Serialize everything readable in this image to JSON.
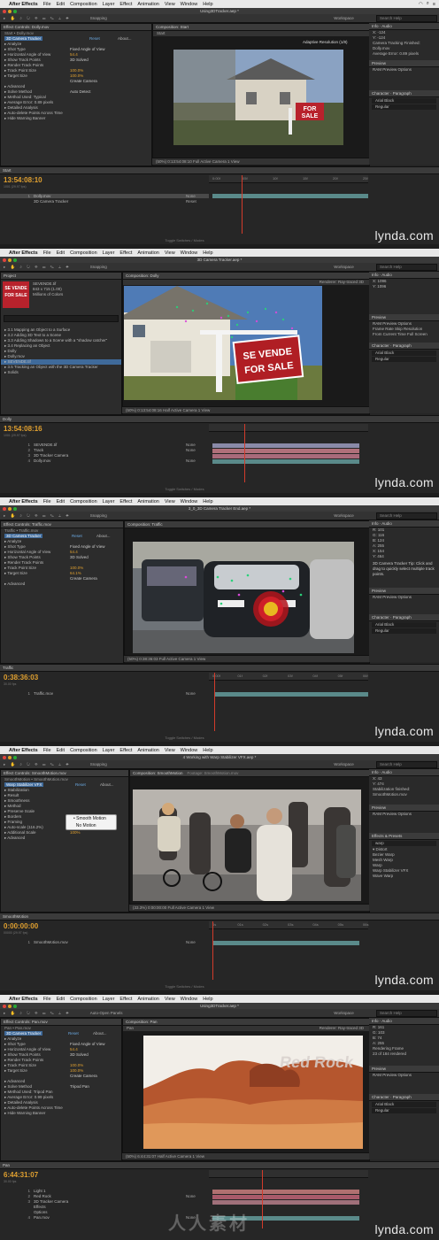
{
  "app": {
    "menu": [
      "After Effects",
      "File",
      "Edit",
      "Composition",
      "Layer",
      "Effect",
      "Animation",
      "View",
      "Window",
      "Help"
    ],
    "snapping": "Snapping",
    "workspace_label": "Workspace",
    "workspace_value": "Standard",
    "search_placeholder": "Search Help",
    "watermark_site": "lynda.com",
    "watermark_cn": "人人素材"
  },
  "frames": [
    {
      "title": "Using3DTracker.aep *",
      "left_panel_tab": "Effect Controls: Dolly.mov",
      "left_panel_path": "Start • Dolly.mov",
      "effect_name": "3D Camera Tracker",
      "reset": "Reset",
      "about": "About...",
      "props": [
        {
          "label": "Analyze",
          "value": ""
        },
        {
          "label": "Shot Type",
          "value": "Fixed Angle of View"
        },
        {
          "label": "Horizontal Angle of View",
          "value": "54.4"
        },
        {
          "label": "Show Track Points",
          "value": "3D Solved"
        },
        {
          "label": "Render Track Points",
          "value": ""
        },
        {
          "label": "Track Point Size",
          "value": "100.0%"
        },
        {
          "label": "Target Size",
          "value": "100.0%"
        },
        {
          "label": "",
          "value": "Create Camera"
        },
        {
          "label": "Advanced",
          "value": ""
        },
        {
          "label": "Solve Method",
          "value": "Auto Detect"
        },
        {
          "label": "Method Used: Typical",
          "value": ""
        },
        {
          "label": "Average Error: 0.89 pixels",
          "value": ""
        },
        {
          "label": "Detailed Analysis",
          "value": ""
        },
        {
          "label": "Auto-delete Points Across Time",
          "value": ""
        },
        {
          "label": "Hide Warning Banner",
          "value": ""
        }
      ],
      "comp_tab": "Composition: Start",
      "comp_sub": "Start",
      "viewer_overlay": "Adaptive Resolution (1/8)",
      "viewer_bar": "(50%)   0:13:54:08:10   Full   Active Camera   1 View",
      "timecode": "13:54:08:10",
      "timecode_sub": "1001 (29.97 fps)",
      "tl_tab": "Start",
      "layers": [
        {
          "num": "1",
          "name": "Dolly.mov",
          "mode": "None"
        },
        {
          "num": "",
          "name": "3D Camera Tracker",
          "mode": "Reset"
        }
      ],
      "ruler": [
        "0:00f",
        "05f",
        "10f",
        "15f",
        "20f",
        "25f"
      ],
      "info_lines": [
        "X: -124",
        "Y: -124",
        "Camera Tracking Finished:",
        "Dolly.mov",
        "Average Error: 0.89 pixels"
      ],
      "preview_label": "RAM Preview Options",
      "char_font": "Arial Black",
      "char_style": "Regular",
      "footer": "Toggle Switches / Modes"
    },
    {
      "title": "3D Camera Tracker.aep *",
      "project_item": "SEVENDE.tif",
      "project_dims": "843 x 715 (1.00)",
      "project_colors": "Millions of Colors",
      "project_list": [
        "3.1 Mapping an Object to a Surface",
        "3.2 Adding 3D Text to a Scene",
        "3.3 Adding Shadows to a Scene with a \"shadow catcher\"",
        "3.4 Replacing an Object",
        "Dolly",
        "Dolly.mov",
        "SEVENDE.tif",
        "3.5 Tracking an Object with the 3D Camera Tracker",
        "Solids"
      ],
      "sign_line1": "SE VENDE",
      "sign_line2": "FOR SALE",
      "comp_tab": "Composition: Dolly",
      "renderer": "Renderer: Ray-traced 3D",
      "viewer_bar": "(50%)   0:13:54:08:16   Half   Active Camera   1 View",
      "timecode": "13:54:08:16",
      "timecode_sub": "1001 (29.97 fps)",
      "tl_tab": "Dolly",
      "layers": [
        {
          "num": "1",
          "name": "SEVENDE.tif",
          "mode": "None"
        },
        {
          "num": "2",
          "name": "Track",
          "mode": "None"
        },
        {
          "num": "3",
          "name": "3D Tracker Camera",
          "mode": ""
        },
        {
          "num": "4",
          "name": "Dolly.mov",
          "mode": "None"
        }
      ],
      "info_lines": [
        "X: 1096",
        "Y: 1096"
      ],
      "preview_label": "RAM Preview Options",
      "frame_rate": "Frame Rate  Skip  Resolution",
      "from_current": "From Current Time   Full Screen",
      "char_font": "Arial Black",
      "char_style": "Regular",
      "footer": "Toggle Switches / Modes"
    },
    {
      "title": "3_0_3D Camera Tracker End.aep *",
      "left_panel_tab": "Effect Controls: Traffic.mov",
      "left_panel_path": "Traffic • Traffic.mov",
      "effect_name": "3D Camera Tracker",
      "reset": "Reset",
      "about": "About...",
      "props": [
        {
          "label": "Analyze",
          "value": ""
        },
        {
          "label": "Shot Type",
          "value": "Fixed Angle of View"
        },
        {
          "label": "Horizontal Angle of View",
          "value": "54.4"
        },
        {
          "label": "Show Track Points",
          "value": "3D Solved"
        },
        {
          "label": "Render Track Points",
          "value": ""
        },
        {
          "label": "Track Point Size",
          "value": "100.0%"
        },
        {
          "label": "Target Size",
          "value": "64.1%"
        },
        {
          "label": "",
          "value": "Create Camera"
        },
        {
          "label": "Advanced",
          "value": ""
        }
      ],
      "comp_tab": "Composition: Traffic",
      "viewer_bar": "(50%)   0:38:36:03   Full   Active Camera   1 View",
      "timecode": "0:38:36:03",
      "timecode_sub": "30.00 fps",
      "tl_tab": "Traffic",
      "layers": [
        {
          "num": "1",
          "name": "Traffic.mov",
          "mode": "None"
        }
      ],
      "ruler": [
        "0:00f",
        "01f",
        "02f",
        "03f",
        "04f",
        "05f",
        "06f"
      ],
      "info_lines": [
        "R: 101",
        "G: 116",
        "B: 124",
        "A: 255",
        "X: 154",
        "Y: 464"
      ],
      "tip": "3D Camera Tracker Tip: Click and drag to quickly select multiple track points.",
      "preview_label": "RAM Preview Options",
      "char_font": "Arial Black",
      "char_style": "Regular",
      "footer": "Toggle Switches / Modes"
    },
    {
      "title": "4 Working with Warp Stabilizer VFX.aep *",
      "left_panel_tab": "Effect Controls: SmoothMotion.mov",
      "left_panel_path": "SmoothMotion • SmoothMotion.mov",
      "effect_name": "Warp Stabilizer VFX",
      "reset": "Reset",
      "about": "About...",
      "props": [
        {
          "label": "Stabilization",
          "value": ""
        },
        {
          "label": "Result",
          "value": ""
        },
        {
          "label": "Smoothness",
          "value": ""
        },
        {
          "label": "Method",
          "value": ""
        },
        {
          "label": "Preserve Scale",
          "value": ""
        },
        {
          "label": "Borders",
          "value": ""
        },
        {
          "label": "Framing",
          "value": "Stabilize, Crop, Auto-scale"
        },
        {
          "label": "Auto-scale (116.2%)",
          "value": ""
        },
        {
          "label": "Additional Scale",
          "value": "100%"
        },
        {
          "label": "Advanced",
          "value": ""
        }
      ],
      "popup": [
        "Smooth Motion",
        "No Motion"
      ],
      "comp_tab": "Composition: SmoothMotion",
      "footage_tab": "Footage: SmoothMotion.mov",
      "viewer_bar": "(33.3%)   0:00:00:00   Full   Active Camera   1 View",
      "timecode": "0:00:00:00",
      "timecode_sub": "00000 (29.97 fps)",
      "tl_tab": "SmoothMotion",
      "layers": [
        {
          "num": "1",
          "name": "SmoothMotion.mov",
          "mode": "None"
        }
      ],
      "ruler": [
        "0s",
        "01s",
        "02s",
        "03s",
        "04s",
        "05s",
        "06s"
      ],
      "info_lines": [
        "X: 43",
        "Y: 474",
        "Stabilization finished:",
        "SmoothMotion.mov"
      ],
      "effects_list": [
        "Distort",
        "Bezier Warp",
        "Mesh Warp",
        "Warp",
        "Warp Stabilizer VFX",
        "Wave Warp"
      ],
      "effects_search": "warp",
      "preview_label": "RAM Preview Options",
      "footer": "Toggle Switches / Modes"
    },
    {
      "title": "Using3DTracker.aep *",
      "left_panel_tab": "Effect Controls: Pan.mov",
      "left_panel_path": "Pan • Pan.mov",
      "effect_name": "3D Camera Tracker",
      "reset": "Reset",
      "about": "About...",
      "props": [
        {
          "label": "Analyze",
          "value": ""
        },
        {
          "label": "Shot Type",
          "value": "Fixed Angle of View"
        },
        {
          "label": "Horizontal Angle of View",
          "value": "54.4"
        },
        {
          "label": "Show Track Points",
          "value": "3D Solved"
        },
        {
          "label": "Render Track Points",
          "value": ""
        },
        {
          "label": "Track Point Size",
          "value": "100.0%"
        },
        {
          "label": "Target Size",
          "value": "100.0%"
        },
        {
          "label": "",
          "value": "Create Camera"
        },
        {
          "label": "Advanced",
          "value": ""
        },
        {
          "label": "Solve Method",
          "value": "Tripod Pan"
        },
        {
          "label": "Method Used: Tripod Pan",
          "value": ""
        },
        {
          "label": "Average Error: 0.99 pixels",
          "value": ""
        },
        {
          "label": "Detailed Analysis",
          "value": ""
        },
        {
          "label": "Auto-delete Points Across Time",
          "value": ""
        },
        {
          "label": "Hide Warning Banner",
          "value": ""
        }
      ],
      "toolbar_extra": "Auto-Open Panels",
      "comp_tab": "Composition: Pan",
      "comp_sub": "Pan",
      "renderer": "Renderer: Ray-traced 3D",
      "red_rock_text": "Red Rock",
      "viewer_bar": "(50%)   6:44:31:07   Half   Active Camera   1 View",
      "timecode": "6:44:31:07",
      "timecode_sub": "30.00 fps",
      "tl_tab": "Pan",
      "layers": [
        {
          "num": "1",
          "name": "Light 1",
          "mode": ""
        },
        {
          "num": "2",
          "name": "Red Rock",
          "mode": "None"
        },
        {
          "num": "3",
          "name": "3D Tracker Camera",
          "mode": ""
        },
        {
          "num": "",
          "name": "Effects",
          "mode": ""
        },
        {
          "num": "",
          "name": "Options",
          "mode": ""
        },
        {
          "num": "4",
          "name": "Pan.mov",
          "mode": "None"
        }
      ],
      "info_lines": [
        "R: 161",
        "G: 103",
        "B: 74",
        "A: 255",
        "Rendering Frame",
        "23 of 184 rendered"
      ],
      "preview_label": "RAM Preview Options",
      "char_font": "Arial Black",
      "char_style": "Regular",
      "footer": "Toggle Switches / Modes"
    }
  ]
}
